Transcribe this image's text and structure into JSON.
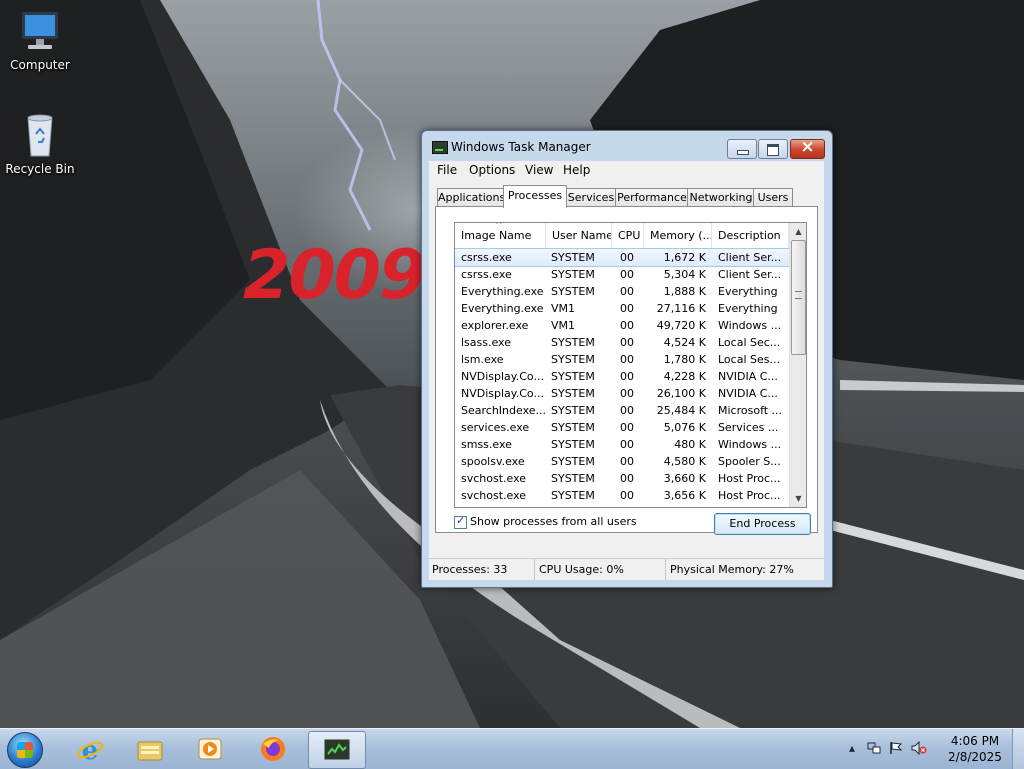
{
  "desktop": {
    "wallpaper_text": "2009",
    "icons": [
      {
        "label": "Computer",
        "icon": "computer-icon"
      },
      {
        "label": "Recycle Bin",
        "icon": "recycle-bin-icon"
      }
    ]
  },
  "window": {
    "title": "Windows Task Manager",
    "menu": [
      "File",
      "Options",
      "View",
      "Help"
    ],
    "tabs": [
      "Applications",
      "Processes",
      "Services",
      "Performance",
      "Networking",
      "Users"
    ],
    "active_tab": "Processes",
    "columns": [
      "Image Name",
      "User Name",
      "CPU",
      "Memory (...",
      "Description"
    ],
    "processes": [
      {
        "name": "csrss.exe",
        "user": "SYSTEM",
        "cpu": "00",
        "memory": "1,672 K",
        "description": "Client Ser...",
        "selected": true
      },
      {
        "name": "csrss.exe",
        "user": "SYSTEM",
        "cpu": "00",
        "memory": "5,304 K",
        "description": "Client Ser..."
      },
      {
        "name": "Everything.exe",
        "user": "SYSTEM",
        "cpu": "00",
        "memory": "1,888 K",
        "description": "Everything"
      },
      {
        "name": "Everything.exe",
        "user": "VM1",
        "cpu": "00",
        "memory": "27,116 K",
        "description": "Everything"
      },
      {
        "name": "explorer.exe",
        "user": "VM1",
        "cpu": "00",
        "memory": "49,720 K",
        "description": "Windows ..."
      },
      {
        "name": "lsass.exe",
        "user": "SYSTEM",
        "cpu": "00",
        "memory": "4,524 K",
        "description": "Local Sec..."
      },
      {
        "name": "lsm.exe",
        "user": "SYSTEM",
        "cpu": "00",
        "memory": "1,780 K",
        "description": "Local Ses..."
      },
      {
        "name": "NVDisplay.Co...",
        "user": "SYSTEM",
        "cpu": "00",
        "memory": "4,228 K",
        "description": "NVIDIA C..."
      },
      {
        "name": "NVDisplay.Co...",
        "user": "SYSTEM",
        "cpu": "00",
        "memory": "26,100 K",
        "description": "NVIDIA C..."
      },
      {
        "name": "SearchIndexe...",
        "user": "SYSTEM",
        "cpu": "00",
        "memory": "25,484 K",
        "description": "Microsoft ..."
      },
      {
        "name": "services.exe",
        "user": "SYSTEM",
        "cpu": "00",
        "memory": "5,076 K",
        "description": "Services ..."
      },
      {
        "name": "smss.exe",
        "user": "SYSTEM",
        "cpu": "00",
        "memory": "480 K",
        "description": "Windows ..."
      },
      {
        "name": "spoolsv.exe",
        "user": "SYSTEM",
        "cpu": "00",
        "memory": "4,580 K",
        "description": "Spooler S..."
      },
      {
        "name": "svchost.exe",
        "user": "SYSTEM",
        "cpu": "00",
        "memory": "3,660 K",
        "description": "Host Proc..."
      },
      {
        "name": "svchost.exe",
        "user": "SYSTEM",
        "cpu": "00",
        "memory": "3,656 K",
        "description": "Host Proc..."
      }
    ],
    "show_all_label": "Show processes from all users",
    "show_all_checked": true,
    "end_process_label": "End Process",
    "status": {
      "processes": "Processes: 33",
      "cpu": "CPU Usage: 0%",
      "memory": "Physical Memory: 27%"
    }
  },
  "taskbar": {
    "pinned": [
      {
        "icon": "internet-explorer-icon"
      },
      {
        "icon": "file-explorer-icon"
      },
      {
        "icon": "media-player-icon"
      },
      {
        "icon": "firefox-icon"
      },
      {
        "icon": "task-manager-icon",
        "active": true
      }
    ],
    "tray_icons": [
      "show-hidden-icons-arrow-icon",
      "network-icon",
      "action-center-flag-icon",
      "volume-muted-icon"
    ],
    "time": "4:06 PM",
    "date": "2/8/2025"
  },
  "colors": {
    "wallpaper_text": "#d9232b",
    "selection": "#dcebfc",
    "titlebar": "#c5d8ec"
  }
}
